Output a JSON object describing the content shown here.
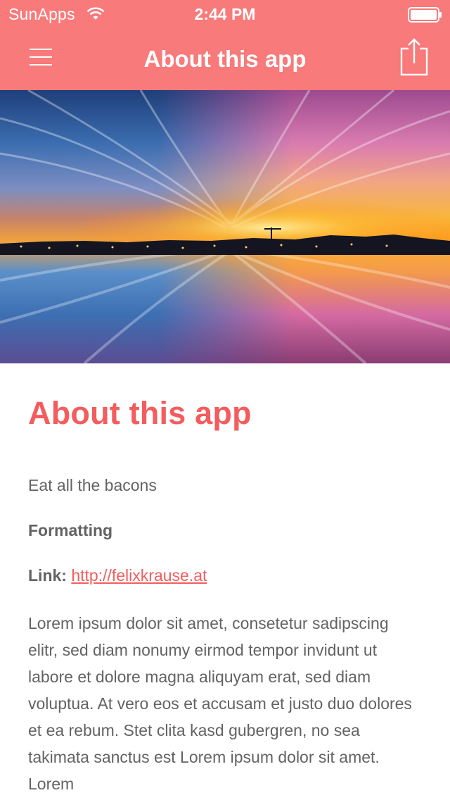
{
  "status_bar": {
    "carrier": "SunApps",
    "time": "2:44 PM",
    "wifi_icon": "wifi-icon",
    "battery_icon": "battery-icon",
    "battery_level": 1.0
  },
  "nav_bar": {
    "title": "About this app",
    "menu_icon": "hamburger-menu-icon",
    "share_icon": "share-icon"
  },
  "hero": {
    "image": "sunset-over-water-photo"
  },
  "content": {
    "heading": "About this app",
    "intro": "Eat all the bacons",
    "formatting": "Formatting",
    "link_label": "Link:",
    "link_text": "http://felixkrause.at",
    "body": "Lorem ipsum dolor sit amet, consetetur sadipscing elitr, sed diam nonumy eirmod tempor invidunt ut labore et dolore magna aliquyam erat, sed diam voluptua. At vero eos et accusam et justo duo dolores et ea rebum. Stet clita kasd gubergren, no sea takimata sanctus est Lorem ipsum dolor sit amet. Lorem"
  },
  "colors": {
    "bar": "#f87a7a",
    "accent": "#f35d5d",
    "text": "#636363"
  }
}
